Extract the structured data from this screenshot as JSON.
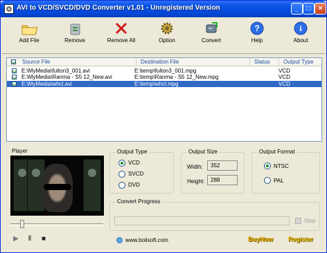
{
  "window": {
    "title": "AVI to VCD/SVCD/DVD Converter v1.01 - Unregistered Version",
    "controls": {
      "minimize": "_",
      "maximize": "□",
      "close": "×"
    }
  },
  "toolbar": [
    {
      "label": "Add File",
      "icon": "folder-icon"
    },
    {
      "label": "Remove",
      "icon": "recycle-icon"
    },
    {
      "label": "Remove All",
      "icon": "red-x-icon"
    },
    {
      "label": "Option",
      "icon": "gear-icon"
    },
    {
      "label": "Convert",
      "icon": "convert-icon"
    },
    {
      "label": "Help",
      "icon": "help-icon"
    },
    {
      "label": "About",
      "icon": "info-icon"
    }
  ],
  "file_table": {
    "headers": [
      "Source File",
      "Destination File",
      "Status",
      "Output Type"
    ],
    "rows": [
      {
        "checked": true,
        "source": "E:\\MyMedia\\fulton3_001.avi",
        "destination": "E:\\temp\\fulton3_001.mpg",
        "status": "",
        "output_type": "VCD",
        "selected": false
      },
      {
        "checked": true,
        "source": "E:\\MyMedia\\Ranma - S5 12_New.avi",
        "destination": "E:\\temp\\Ranma - S5 12_New.mpg",
        "status": "",
        "output_type": "VCD",
        "selected": false
      },
      {
        "checked": true,
        "source": "E:\\MyMedia\\whcl.avi",
        "destination": "E:\\temp\\whcl.mpg",
        "status": "",
        "output_type": "VCD",
        "selected": true
      }
    ]
  },
  "player": {
    "title": "Player",
    "controls": {
      "play": "▶",
      "pause": "Ⅱ",
      "stop": "■"
    }
  },
  "output_type": {
    "title": "Output Type",
    "options": [
      "VCD",
      "SVCD",
      "DVD"
    ],
    "selected": "VCD"
  },
  "output_size": {
    "title": "Output Size",
    "width_label": "Width:",
    "width": "352",
    "height_label": "Height:",
    "height": "288"
  },
  "output_format": {
    "title": "Output Format",
    "options": [
      "NTSC",
      "PAL"
    ],
    "selected": "NTSC"
  },
  "convert_progress": {
    "title": "Convert Progress",
    "value": 0,
    "stop": "Stop"
  },
  "footer": {
    "website": "www.boilsoft.com",
    "buy_now": "BuyNow",
    "register": "Register"
  }
}
